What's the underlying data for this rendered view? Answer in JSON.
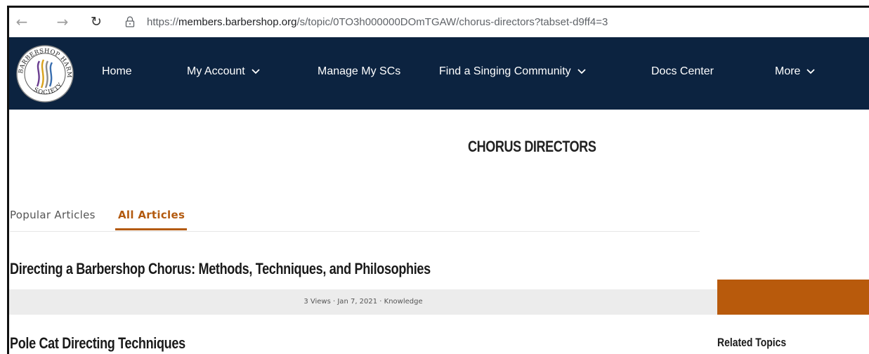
{
  "browser": {
    "url_prefix": "https://",
    "url_host": "members.barbershop.org",
    "url_path": "/s/topic/0TO3h000000DOmTGAW/chorus-directors?tabset-d9ff4=3"
  },
  "nav": {
    "items": [
      {
        "label": "Home",
        "has_menu": false
      },
      {
        "label": "My Account",
        "has_menu": true
      },
      {
        "label": "Manage My SCs",
        "has_menu": false
      },
      {
        "label": "Find a Singing Community",
        "has_menu": true
      },
      {
        "label": "Docs Center",
        "has_menu": false
      },
      {
        "label": "More",
        "has_menu": true
      }
    ],
    "background": "#0c2340"
  },
  "page": {
    "title": "CHORUS DIRECTORS",
    "tabs": [
      {
        "label": "Popular Articles",
        "active": false
      },
      {
        "label": "All Articles",
        "active": true
      }
    ],
    "articles": [
      {
        "title": "Directing a Barbershop Chorus: Methods, Techniques, and Philosophies",
        "meta": "3 Views  ·  Jan 7, 2021  ·  Knowledge"
      },
      {
        "title": "Pole Cat Directing Techniques"
      }
    ],
    "accent": "#b35a0f"
  },
  "sidebar": {
    "related_heading": "Related Topics"
  }
}
